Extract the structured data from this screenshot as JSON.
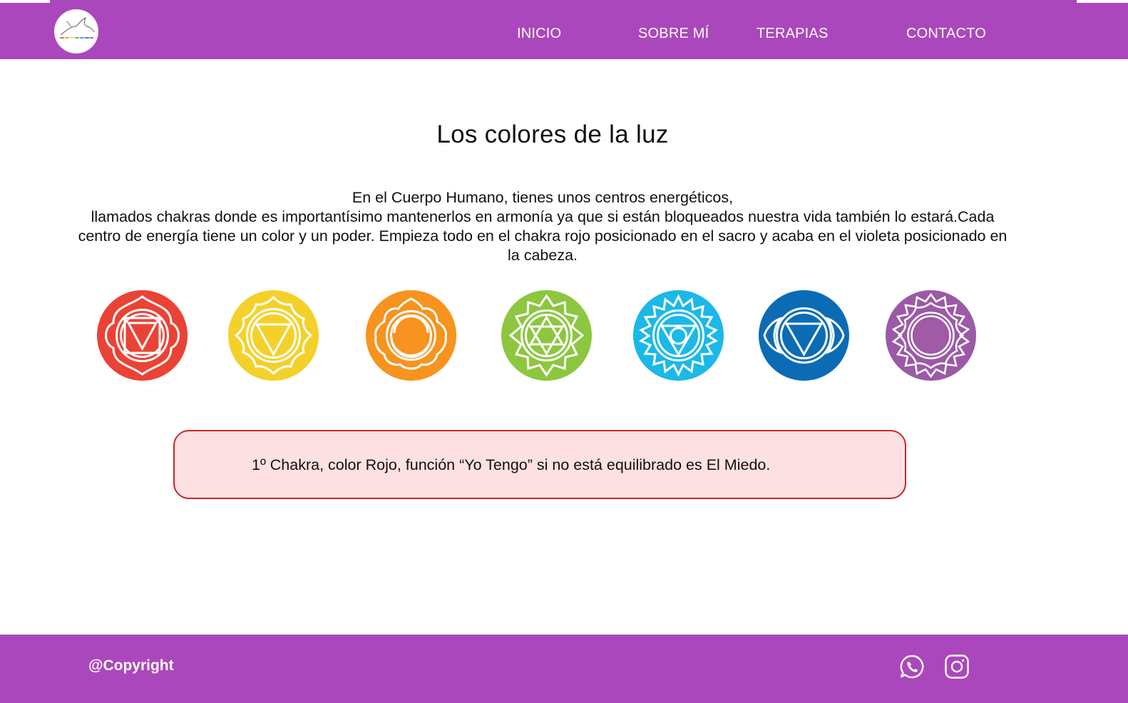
{
  "header": {
    "logo_text": "Los colores de la luz",
    "nav": [
      {
        "label": "INICIO"
      },
      {
        "label": "SOBRE MÍ"
      },
      {
        "label": "TERAPIAS"
      },
      {
        "label": "CONTACTO"
      }
    ]
  },
  "main": {
    "title": "Los colores de la luz",
    "intro": [
      "En el Cuerpo Humano, tienes unos centros energéticos,",
      "llamados chakras donde es importantísimo mantenerlos en armonía ya que si están bloqueados nuestra vida también lo estará.Cada centro de energía tiene un color y un poder. Empieza todo en el chakra rojo posicionado en el sacro y acaba en el violeta posicionado en la cabeza."
    ],
    "chakras": [
      {
        "icon": "root-chakra-icon",
        "color": "#ea4335"
      },
      {
        "icon": "solar-plexus-chakra-icon",
        "color": "#f4d12a"
      },
      {
        "icon": "sacral-chakra-icon",
        "color": "#f7931e"
      },
      {
        "icon": "heart-chakra-icon",
        "color": "#8dc63f"
      },
      {
        "icon": "throat-chakra-icon",
        "color": "#1bb8e8"
      },
      {
        "icon": "third-eye-chakra-icon",
        "color": "#0b6cb5"
      },
      {
        "icon": "crown-chakra-icon",
        "color": "#9b59a6"
      }
    ],
    "info_box": {
      "text": "1º Chakra, color Rojo, función “Yo Tengo” si no está equilibrado es El Miedo.",
      "border_color": "#c62828",
      "background": "#fde0e2"
    }
  },
  "footer": {
    "copyright": "@Copyright",
    "social": [
      {
        "icon": "whatsapp-icon"
      },
      {
        "icon": "instagram-icon"
      }
    ]
  },
  "colors": {
    "brand": "#ab47bc",
    "text": "#111111"
  }
}
